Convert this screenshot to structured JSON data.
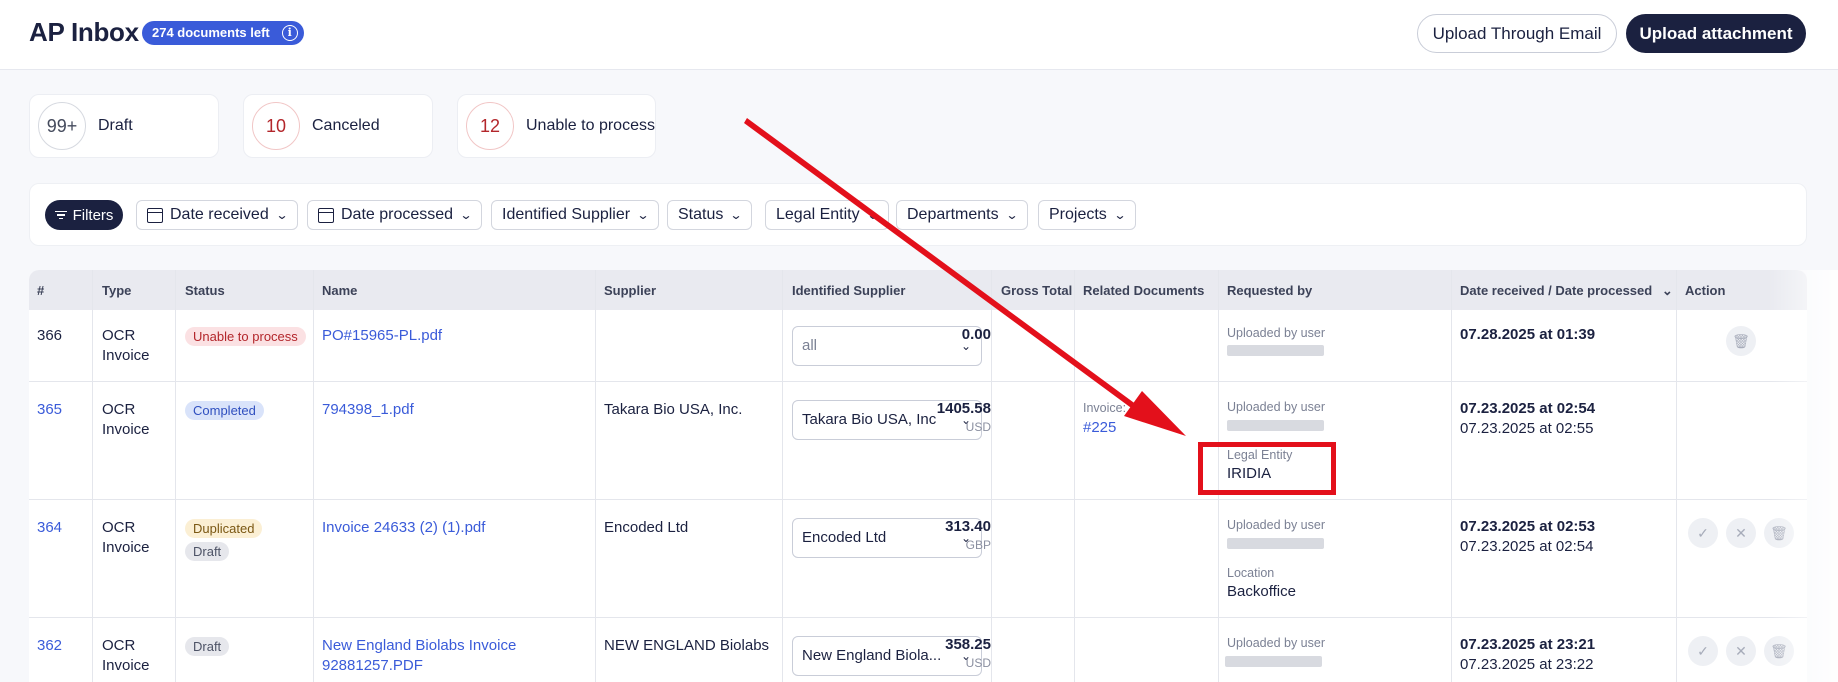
{
  "header": {
    "title": "AP Inbox",
    "docs_left": "274 documents left",
    "info_icon": "i",
    "upload_email": "Upload Through Email",
    "upload_attachment": "Upload attachment"
  },
  "stats": [
    {
      "count": "99+",
      "label": "Draft"
    },
    {
      "count": "10",
      "label": "Canceled"
    },
    {
      "count": "12",
      "label": "Unable to process"
    }
  ],
  "filters": {
    "filters_label": "Filters",
    "date_received": "Date received",
    "date_processed": "Date processed",
    "identified_supplier": "Identified Supplier",
    "status": "Status",
    "legal_entity": "Legal Entity",
    "departments": "Departments",
    "projects": "Projects"
  },
  "columns": {
    "num": "#",
    "type": "Type",
    "status": "Status",
    "name": "Name",
    "supplier": "Supplier",
    "identified_supplier": "Identified Supplier",
    "gross_total": "Gross Total",
    "related_documents": "Related Documents",
    "requested_by": "Requested by",
    "dates": "Date received / Date processed",
    "action": "Action"
  },
  "rows": [
    {
      "num": "366",
      "type1": "OCR",
      "type2": "Invoice",
      "status": "Unable to process",
      "name": "PO#15965-PL.pdf",
      "supplier": "",
      "identified": "all",
      "amount": "0.00",
      "currency": "",
      "requested_label": "Uploaded by user",
      "date1": "07.28.2025 at 01:39",
      "date2": ""
    },
    {
      "num": "365",
      "type1": "OCR",
      "type2": "Invoice",
      "status": "Completed",
      "name": "794398_1.pdf",
      "supplier": "Takara Bio USA, Inc.",
      "identified": "Takara Bio USA, Inc",
      "amount": "1405.58",
      "currency": "USD",
      "related_label": "Invoice:",
      "related_link": "#225",
      "requested_label": "Uploaded by user",
      "extra_label": "Legal Entity",
      "extra_value": "IRIDIA",
      "date1": "07.23.2025 at 02:54",
      "date2": "07.23.2025 at 02:55"
    },
    {
      "num": "364",
      "type1": "OCR",
      "type2": "Invoice",
      "status": "Duplicated",
      "status2": "Draft",
      "name": "Invoice 24633 (2) (1).pdf",
      "supplier": "Encoded Ltd",
      "identified": "Encoded Ltd",
      "amount": "313.40",
      "currency": "GBP",
      "requested_label": "Uploaded by user",
      "extra_label": "Location",
      "extra_value": "Backoffice",
      "date1": "07.23.2025 at 02:53",
      "date2": "07.23.2025 at 02:54"
    },
    {
      "num": "362",
      "type1": "OCR",
      "type2": "Invoice",
      "status": "Draft",
      "name1": "New England Biolabs Invoice",
      "name2": "92881257.PDF",
      "supplier": "NEW ENGLAND Biolabs",
      "identified": "New England Biola...",
      "amount": "358.25",
      "currency": "USD",
      "requested_label": "Uploaded by user",
      "date1": "07.23.2025 at 23:21",
      "date2": "07.23.2025 at 23:22"
    }
  ],
  "icons": {
    "chevron": "⌄",
    "check": "✓",
    "close": "✕",
    "trash": "🗑"
  }
}
